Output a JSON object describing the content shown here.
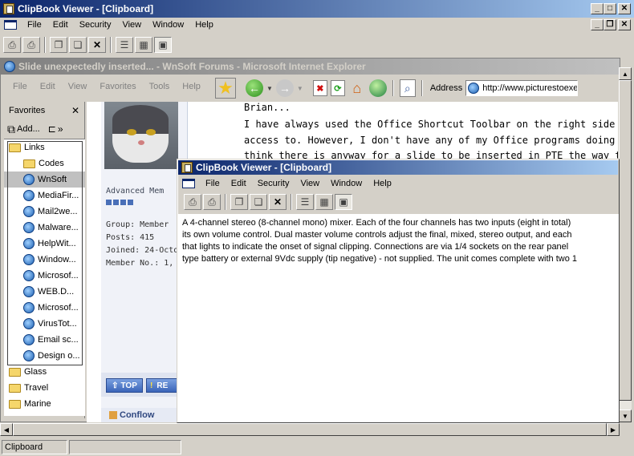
{
  "outer_window": {
    "title": "ClipBook Viewer - [Clipboard]",
    "menu": [
      "File",
      "Edit",
      "Security",
      "View",
      "Window",
      "Help"
    ],
    "status": "Clipboard"
  },
  "ie_window": {
    "title": "Slide unexpectedly inserted... - WnSoft Forums - Microsoft Internet Explorer",
    "menu": [
      "File",
      "Edit",
      "View",
      "Favorites",
      "Tools",
      "Help"
    ],
    "address_label": "Address",
    "address_value": "http://www.picturestoexe"
  },
  "favorites": {
    "title": "Favorites",
    "add_label": "Add...",
    "items": [
      {
        "label": "Links",
        "type": "folder",
        "level": 0
      },
      {
        "label": "Codes",
        "type": "folder",
        "level": 1
      },
      {
        "label": "WnSoft",
        "type": "link",
        "level": 1,
        "selected": true
      },
      {
        "label": "MediaFir...",
        "type": "link",
        "level": 1
      },
      {
        "label": "Mail2we...",
        "type": "link",
        "level": 1
      },
      {
        "label": "Malware...",
        "type": "link",
        "level": 1
      },
      {
        "label": "HelpWit...",
        "type": "link",
        "level": 1
      },
      {
        "label": "Window...",
        "type": "link",
        "level": 1
      },
      {
        "label": "Microsof...",
        "type": "link",
        "level": 1
      },
      {
        "label": "WEB.D...",
        "type": "link",
        "level": 1
      },
      {
        "label": "Microsof...",
        "type": "link",
        "level": 1
      },
      {
        "label": "VirusTot...",
        "type": "link",
        "level": 1
      },
      {
        "label": "Email sc...",
        "type": "link",
        "level": 1
      },
      {
        "label": "Design o...",
        "type": "link",
        "level": 1
      },
      {
        "label": "Glass",
        "type": "folder",
        "level": 0
      },
      {
        "label": "Travel",
        "type": "folder",
        "level": 0
      },
      {
        "label": "Marine",
        "type": "folder",
        "level": 0
      }
    ]
  },
  "forum": {
    "rank": "Advanced Mem",
    "group": "Group: Member",
    "posts": "Posts: 415",
    "joined": "Joined: 24-Octo",
    "member_no": "Member No.: 1,",
    "post_line1": "Brian...",
    "post_line2": "I have always used the Office Shortcut Toolbar on the right side of my Des",
    "post_line3": "access to. However, I don't have any of my Office programs doing autosav",
    "post_line4": "think there is anyway for a slide to be inserted in PTE the way this happen",
    "top_button": "TOP",
    "report_button": "RE",
    "next_user": "Conflow"
  },
  "inner_window": {
    "title": "ClipBook Viewer - [Clipboard]",
    "menu": [
      "File",
      "Edit",
      "Security",
      "View",
      "Window",
      "Help"
    ],
    "content_line1": "A 4-channel stereo (8-channel mono) mixer. Each of the four channels has two inputs (eight in total)",
    "content_line2": "its own volume control. Dual master volume controls adjust the final, mixed, stereo output, and each",
    "content_line3": "that lights to indicate the onset of signal clipping. Connections are via 1/4 sockets on the rear panel",
    "content_line4": "type battery or external 9Vdc supply (tip negative) - not supplied. The unit comes complete with two 1"
  },
  "colors": {
    "active_title": "#0a246a",
    "inactive_title": "#808080",
    "face": "#d4d0c8"
  }
}
